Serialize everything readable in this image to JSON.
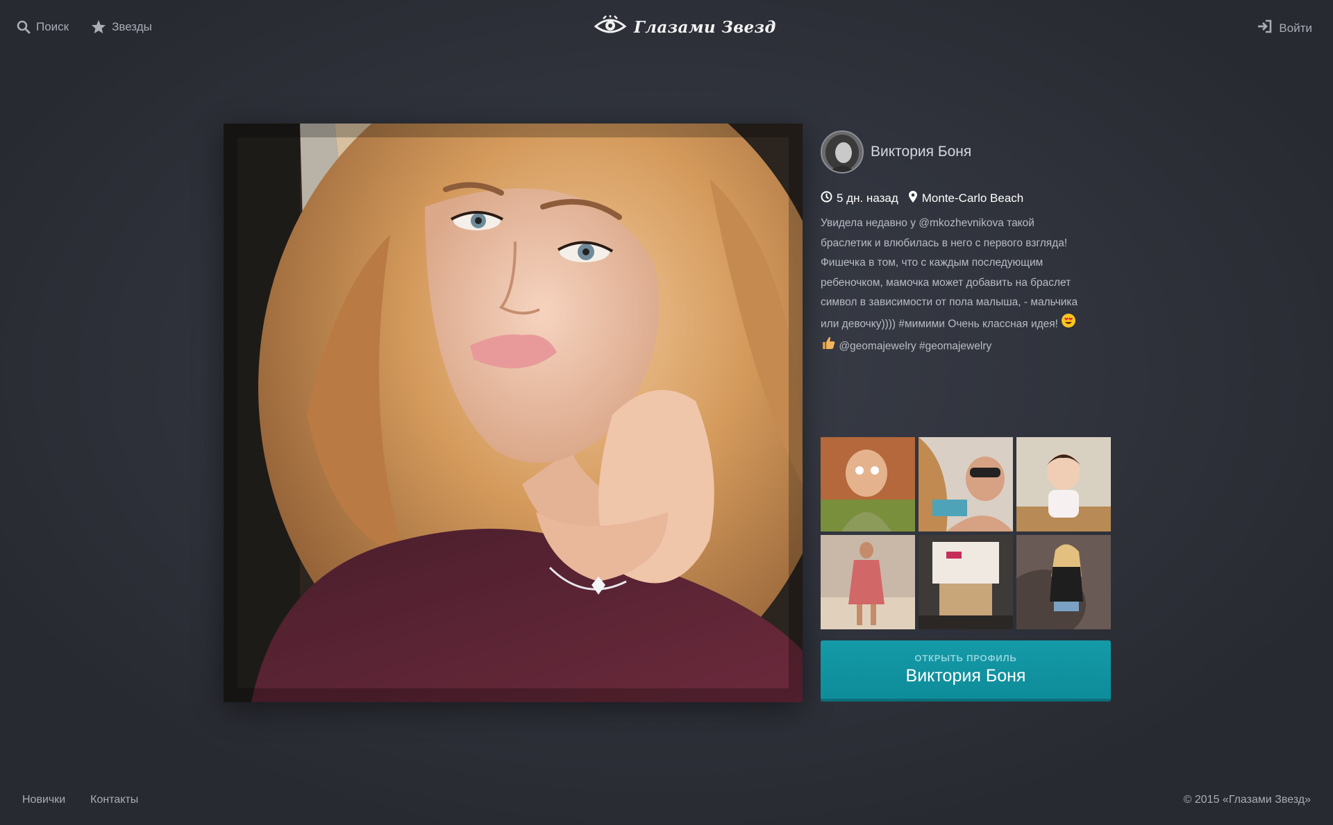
{
  "header": {
    "search_label": "Поиск",
    "stars_label": "Звезды",
    "logo_text": "Глазами Звезд",
    "login_label": "Войти"
  },
  "post": {
    "author_name": "Виктория Боня",
    "time_ago": "5 дн. назад",
    "location": "Monte-Carlo Beach",
    "caption_lines": [
      "Увидела недавно у @mkozhevnikova такой",
      "браслетик и влюбилась в него с первого взгляда!",
      "Фишечка в том, что с каждым последующим",
      "ребеночком, мамочка может добавить на браслет",
      "символ в зависимости от пола малыша, - мальчика",
      "или девочку)))) #мимими Очень классная идея!",
      "@geomajewelry #geomajewelry"
    ]
  },
  "open_profile": {
    "small_label": "ОТКРЫТЬ ПРОФИЛЬ",
    "name": "Виктория Боня"
  },
  "footer": {
    "newbies_label": "Новички",
    "contacts_label": "Контакты",
    "copyright": "© 2015 «Глазами Звезд»"
  },
  "colors": {
    "accent_button": "#0e8c99",
    "background": "#30333c"
  },
  "icons": {
    "search": "search-icon",
    "star": "star-icon",
    "logo": "eye-logo-icon",
    "login": "login-icon",
    "clock": "clock-icon",
    "location": "map-pin-icon",
    "emoji_heart_eyes": "heart-eyes-emoji-icon",
    "emoji_thumbs_up": "thumbs-up-emoji-icon"
  }
}
